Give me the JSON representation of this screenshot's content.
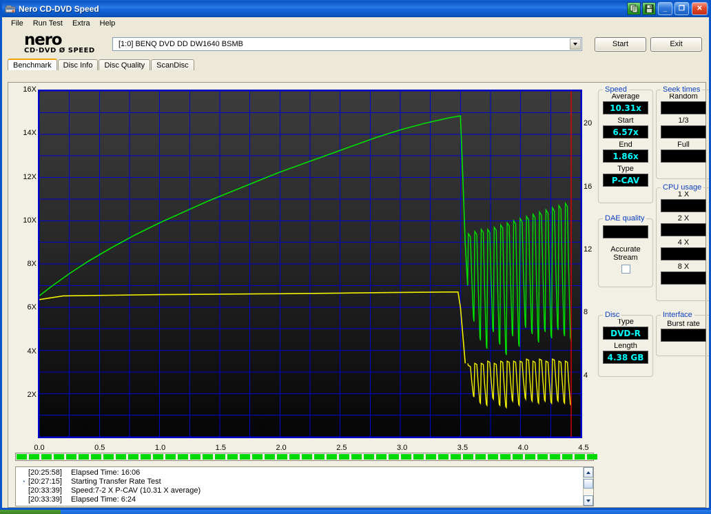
{
  "window": {
    "title": "Nero CD-DVD Speed",
    "icon": "disc-drive-icon",
    "buttons": {
      "copy": "copy-to-clipboard-icon",
      "save": "save-icon",
      "minimize": "_",
      "maximize": "❐",
      "close": "✕"
    }
  },
  "menu": {
    "items": [
      "File",
      "Run Test",
      "Extra",
      "Help"
    ]
  },
  "logo": {
    "line1": "nero",
    "line2": "CD·DVD Ø SPEED"
  },
  "drive": {
    "value": "[1:0]   BENQ DVD DD DW1640 BSMB"
  },
  "actions": {
    "start": "Start",
    "exit": "Exit"
  },
  "tabs": [
    {
      "label": "Benchmark",
      "active": true
    },
    {
      "label": "Disc Info",
      "active": false
    },
    {
      "label": "Disc Quality",
      "active": false
    },
    {
      "label": "ScanDisc",
      "active": false
    }
  ],
  "panels": {
    "speed": {
      "caption": "Speed",
      "rows": [
        {
          "label": "Average",
          "value": "10.31x"
        },
        {
          "label": "Start",
          "value": "6.57x"
        },
        {
          "label": "End",
          "value": "1.86x"
        },
        {
          "label": "Type",
          "value": "P-CAV"
        }
      ]
    },
    "dae": {
      "caption": "DAE quality",
      "value": "",
      "checkbox_label_1": "Accurate",
      "checkbox_label_2": "Stream",
      "checked": false
    },
    "disc": {
      "caption": "Disc",
      "rows": [
        {
          "label": "Type",
          "value": "DVD-R"
        },
        {
          "label": "Length",
          "value": "4.38 GB"
        }
      ]
    },
    "seek": {
      "caption": "Seek times",
      "rows": [
        {
          "label": "Random",
          "value": ""
        },
        {
          "label": "1/3",
          "value": ""
        },
        {
          "label": "Full",
          "value": ""
        }
      ]
    },
    "cpu": {
      "caption": "CPU usage",
      "rows": [
        {
          "label": "1 X",
          "value": ""
        },
        {
          "label": "2 X",
          "value": ""
        },
        {
          "label": "4 X",
          "value": ""
        },
        {
          "label": "8 X",
          "value": ""
        }
      ]
    },
    "interface": {
      "caption": "Interface",
      "rows": [
        {
          "label": "Burst rate",
          "value": ""
        }
      ]
    }
  },
  "progress": {
    "percent": 100,
    "segments": 47
  },
  "log": {
    "lines": [
      {
        "bullet": "",
        "time": "[20:25:58]",
        "text": "Elapsed Time: 16:06"
      },
      {
        "bullet": "◔",
        "time": "[20:27:15]",
        "text": "Starting Transfer Rate Test"
      },
      {
        "bullet": "",
        "time": "[20:33:39]",
        "text": "Speed:7-2 X P-CAV (10.31 X average)"
      },
      {
        "bullet": "",
        "time": "[20:33:39]",
        "text": "Elapsed Time:  6:24"
      }
    ]
  },
  "chart_data": {
    "type": "line",
    "title": "",
    "xlabel": "",
    "ylabel": "",
    "xlim": [
      0,
      4.5
    ],
    "ylim": [
      0,
      16
    ],
    "y2lim": [
      0,
      22.16
    ],
    "grid": true,
    "legend": "none",
    "xticks": [
      "0.0",
      "0.5",
      "1.0",
      "1.5",
      "2.0",
      "2.5",
      "3.0",
      "3.5",
      "4.0",
      "4.5"
    ],
    "xtick_values": [
      0,
      0.5,
      1.0,
      1.5,
      2.0,
      2.5,
      3.0,
      3.5,
      4.0,
      4.5
    ],
    "yticks": [
      "2X",
      "4X",
      "6X",
      "8X",
      "10X",
      "12X",
      "14X",
      "16X"
    ],
    "ytick_values": [
      2,
      4,
      6,
      8,
      10,
      12,
      14,
      16
    ],
    "y2ticks": [
      "4",
      "8",
      "12",
      "16",
      "20"
    ],
    "y2tick_values": [
      4,
      8,
      12,
      16,
      20
    ],
    "gridline_step_y": 1,
    "gridline_step_x": 0.25,
    "colors": {
      "read_speed": "#00e000",
      "dae_yellow": "#f0f000",
      "grid": "#0000d0",
      "marker": "#e00000",
      "plot_bg_top": "#3c3c3c",
      "plot_bg_bottom": "#050505"
    },
    "series": [
      {
        "name": "Read transfer rate",
        "color": "#00e000",
        "x": [
          0.0,
          0.1,
          0.25,
          0.4,
          0.6,
          0.8,
          1.0,
          1.2,
          1.4,
          1.6,
          1.8,
          2.0,
          2.2,
          2.4,
          2.6,
          2.8,
          3.0,
          3.2,
          3.4,
          3.48,
          3.5,
          3.52,
          3.54,
          3.56
        ],
        "y": [
          6.52,
          6.95,
          7.55,
          8.1,
          8.75,
          9.35,
          9.9,
          10.4,
          10.9,
          11.35,
          11.8,
          12.25,
          12.65,
          13.05,
          13.45,
          13.85,
          14.2,
          14.5,
          14.75,
          14.83,
          14.85,
          12.0,
          8.9,
          7.0
        ]
      },
      {
        "name": "Read transfer rate (oscillating tail)",
        "color": "#00e000",
        "note": "sawtooth oscillation between ~3.5 and ~11 x from 3.56 GB to 4.42 GB, rising envelope",
        "x_start": 3.56,
        "x_end": 4.42,
        "peaks": [
          9.4,
          9.5,
          9.6,
          9.6,
          9.7,
          9.8,
          9.9,
          10.0,
          10.1,
          10.2,
          10.3,
          10.4,
          10.5,
          10.6,
          10.7,
          10.8
        ],
        "troughs": [
          5.5,
          4.6,
          4.2,
          5.0,
          4.4,
          3.9,
          4.8,
          4.3,
          5.2,
          4.9,
          4.5,
          5.0,
          4.7,
          5.1,
          4.8,
          4.6
        ]
      },
      {
        "name": "DAE / CPU curve",
        "color": "#f0f000",
        "x": [
          0.0,
          0.2,
          0.6,
          1.0,
          1.5,
          2.0,
          2.5,
          3.0,
          3.4,
          3.48,
          3.5,
          3.54
        ],
        "y": [
          6.35,
          6.52,
          6.55,
          6.58,
          6.6,
          6.62,
          6.65,
          6.68,
          6.7,
          6.7,
          6.0,
          3.4
        ]
      },
      {
        "name": "DAE / CPU curve (oscillating tail)",
        "color": "#f0f000",
        "note": "sawtooth oscillation between ~1.3 and ~3.6 x from 3.56 GB to 4.42 GB",
        "x_start": 3.56,
        "x_end": 4.42,
        "peaks": [
          3.3,
          3.4,
          3.4,
          3.5,
          3.4,
          3.5,
          3.5,
          3.5,
          3.5,
          3.6,
          3.5,
          3.6,
          3.5,
          3.6,
          3.5,
          3.5
        ],
        "troughs": [
          1.9,
          1.6,
          1.5,
          1.8,
          1.5,
          1.4,
          1.7,
          1.5,
          1.8,
          1.7,
          1.6,
          1.7,
          1.6,
          1.7,
          1.6,
          1.5
        ]
      }
    ],
    "markers": [
      {
        "name": "end-of-disc-marker",
        "x": 4.42,
        "color": "#e00000",
        "orientation": "vertical"
      }
    ]
  }
}
